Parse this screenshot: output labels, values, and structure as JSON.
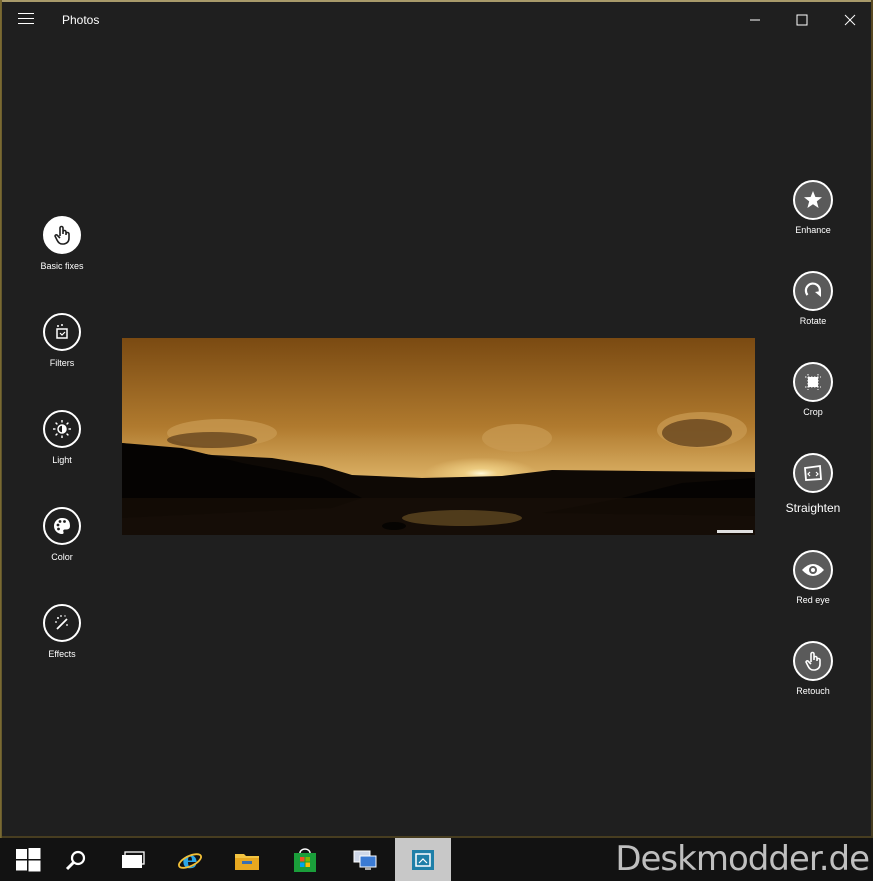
{
  "app": {
    "title": "Photos"
  },
  "left_tools": [
    {
      "label": "Basic fixes",
      "icon": "hand-touch-icon",
      "selected": true
    },
    {
      "label": "Filters",
      "icon": "filters-icon"
    },
    {
      "label": "Light",
      "icon": "brightness-icon"
    },
    {
      "label": "Color",
      "icon": "palette-icon"
    },
    {
      "label": "Effects",
      "icon": "effects-wand-icon"
    }
  ],
  "right_tools": [
    {
      "label": "Enhance",
      "icon": "star-icon"
    },
    {
      "label": "Rotate",
      "icon": "rotate-icon"
    },
    {
      "label": "Crop",
      "icon": "crop-icon"
    },
    {
      "label": "Straighten",
      "icon": "straighten-icon"
    },
    {
      "label": "Red eye",
      "icon": "eye-icon"
    },
    {
      "label": "Retouch",
      "icon": "hand-touch-icon"
    }
  ],
  "taskbar": {
    "items": [
      "start-icon",
      "search-icon",
      "task-view-icon",
      "internet-explorer-icon",
      "file-explorer-icon",
      "store-icon",
      "remote-desktop-icon",
      "photos-app-icon"
    ],
    "active": "photos-app-icon"
  },
  "watermark": "Deskmodder.de",
  "colors": {
    "window_bg": "#1f1f1f",
    "taskbar_bg": "#121212",
    "tool_bg": "#5a5a5a"
  }
}
